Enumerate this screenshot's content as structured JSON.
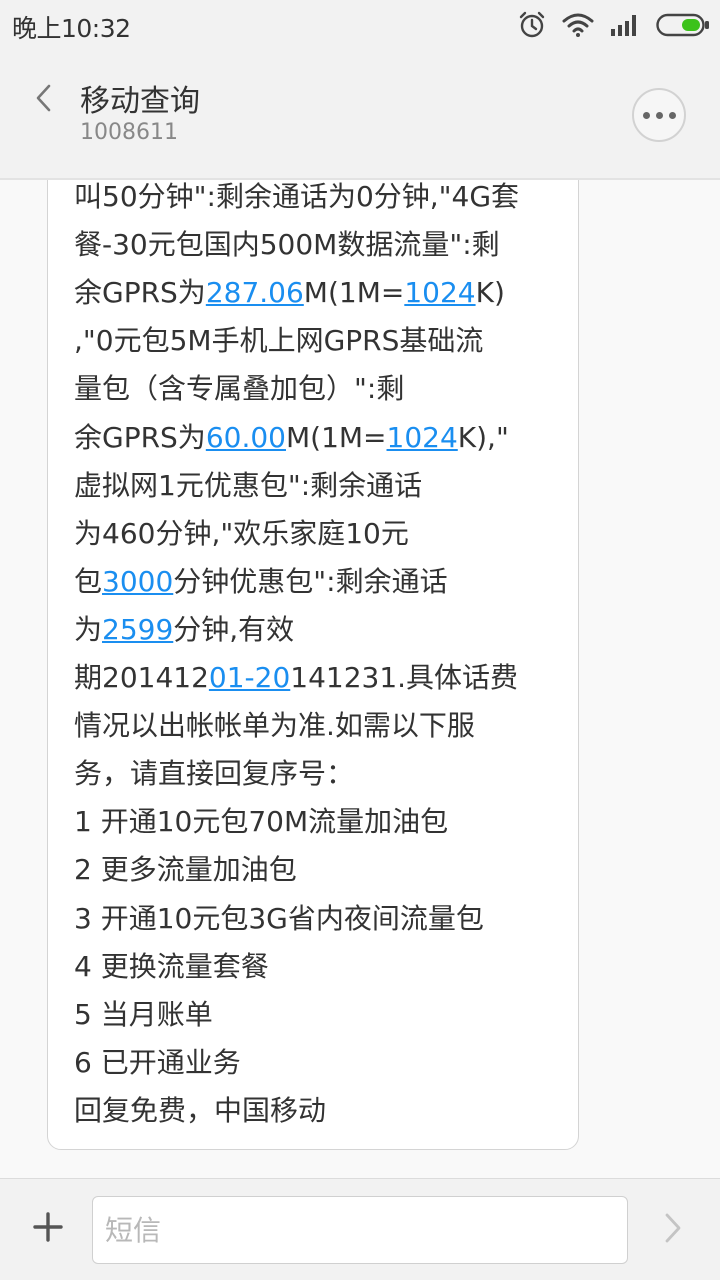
{
  "status_bar": {
    "time": "晚上10:32",
    "icons": [
      "alarm-icon",
      "wifi-icon",
      "signal-icon",
      "battery-icon"
    ],
    "battery_color": "#3cc21a"
  },
  "header": {
    "title": "移动查询",
    "number": "1008611",
    "back_icon": "chevron-left-icon",
    "more_icon": "more-icon"
  },
  "message": {
    "lines": [
      [
        {
          "t": "叫50分钟\":剩余通话为0分钟,\"4G套"
        }
      ],
      [
        {
          "t": "餐-30元包国内500M数据流量\":剩"
        }
      ],
      [
        {
          "t": "余GPRS为"
        },
        {
          "t": "287.06",
          "link": true
        },
        {
          "t": "M(1M="
        },
        {
          "t": "1024",
          "link": true
        },
        {
          "t": "K)"
        }
      ],
      [
        {
          "t": ",\"0元包5M手机上网GPRS基础流"
        }
      ],
      [
        {
          "t": "量包（含专属叠加包）\":剩"
        }
      ],
      [
        {
          "t": "余GPRS为"
        },
        {
          "t": "60.00",
          "link": true
        },
        {
          "t": "M(1M="
        },
        {
          "t": "1024",
          "link": true
        },
        {
          "t": "K),\""
        }
      ],
      [
        {
          "t": "虚拟网1元优惠包\":剩余通话"
        }
      ],
      [
        {
          "t": "为460分钟,\"欢乐家庭10元"
        }
      ],
      [
        {
          "t": "包"
        },
        {
          "t": "3000",
          "link": true
        },
        {
          "t": "分钟优惠包\":剩余通话"
        }
      ],
      [
        {
          "t": "为"
        },
        {
          "t": "2599",
          "link": true
        },
        {
          "t": "分钟,有效"
        }
      ],
      [
        {
          "t": "期201412"
        },
        {
          "t": "01-20",
          "link": true
        },
        {
          "t": "141231.具体话费"
        }
      ],
      [
        {
          "t": "情况以出帐帐单为准.如需以下服"
        }
      ],
      [
        {
          "t": "务，请直接回复序号："
        }
      ],
      [
        {
          "t": "1 开通10元包70M流量加油包"
        }
      ],
      [
        {
          "t": "2 更多流量加油包"
        }
      ],
      [
        {
          "t": "3 开通10元包3G省内夜间流量包"
        }
      ],
      [
        {
          "t": "4 更换流量套餐"
        }
      ],
      [
        {
          "t": "5 当月账单"
        }
      ],
      [
        {
          "t": "6 已开通业务"
        }
      ],
      [
        {
          "t": "回复免费，中国移动"
        }
      ]
    ],
    "link_color": "#1a8ef0"
  },
  "input_bar": {
    "add_icon": "plus-icon",
    "placeholder": "短信",
    "value": "",
    "send_icon": "send-chevron-icon"
  }
}
